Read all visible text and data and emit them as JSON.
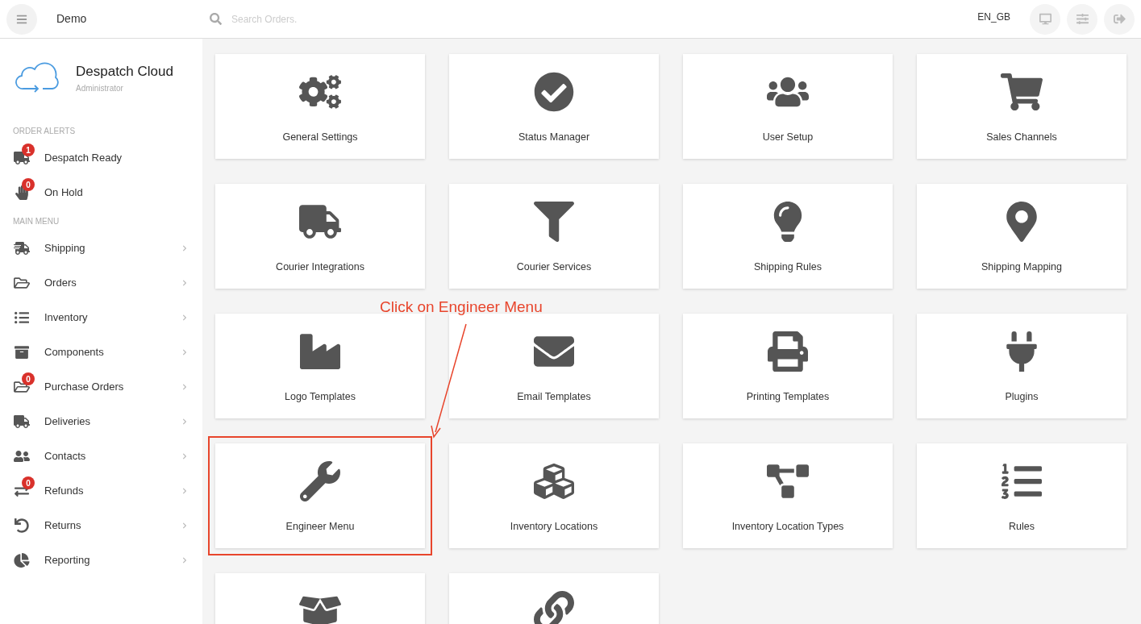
{
  "topbar": {
    "title": "Demo",
    "search": {
      "placeholder": "Search Orders."
    },
    "locale": "EN_GB"
  },
  "sidebar": {
    "brand": {
      "name": "Despatch Cloud",
      "role": "Administrator"
    },
    "sections": [
      {
        "heading": "ORDER ALERTS",
        "items": [
          {
            "label": "Despatch Ready",
            "badge": "1",
            "submenu": false
          },
          {
            "label": "On Hold",
            "badge": "0",
            "submenu": false
          }
        ]
      },
      {
        "heading": "MAIN MENU",
        "items": [
          {
            "label": "Shipping",
            "submenu": true
          },
          {
            "label": "Orders",
            "submenu": true
          },
          {
            "label": "Inventory",
            "submenu": true
          },
          {
            "label": "Components",
            "submenu": true
          },
          {
            "label": "Purchase Orders",
            "badge": "0",
            "submenu": true
          },
          {
            "label": "Deliveries",
            "submenu": true
          },
          {
            "label": "Contacts",
            "submenu": true
          },
          {
            "label": "Refunds",
            "badge": "0",
            "submenu": true
          },
          {
            "label": "Returns",
            "submenu": true
          },
          {
            "label": "Reporting",
            "submenu": true
          }
        ]
      }
    ]
  },
  "tiles": [
    {
      "label": "General Settings",
      "highlighted": false
    },
    {
      "label": "Status Manager",
      "highlighted": false
    },
    {
      "label": "User Setup",
      "highlighted": false
    },
    {
      "label": "Sales Channels",
      "highlighted": false
    },
    {
      "label": "Courier Integrations",
      "highlighted": false
    },
    {
      "label": "Courier Services",
      "highlighted": false
    },
    {
      "label": "Shipping Rules",
      "highlighted": false
    },
    {
      "label": "Shipping Mapping",
      "highlighted": false
    },
    {
      "label": "Logo Templates",
      "highlighted": false
    },
    {
      "label": "Email Templates",
      "highlighted": false
    },
    {
      "label": "Printing Templates",
      "highlighted": false
    },
    {
      "label": "Plugins",
      "highlighted": false
    },
    {
      "label": "Engineer Menu",
      "highlighted": true
    },
    {
      "label": "Inventory Locations",
      "highlighted": false
    },
    {
      "label": "Inventory Location Types",
      "highlighted": false
    },
    {
      "label": "Rules",
      "highlighted": false
    },
    {
      "highlighted": false
    },
    {
      "highlighted": false
    }
  ],
  "annotation": {
    "text": "Click on Engineer Menu"
  }
}
